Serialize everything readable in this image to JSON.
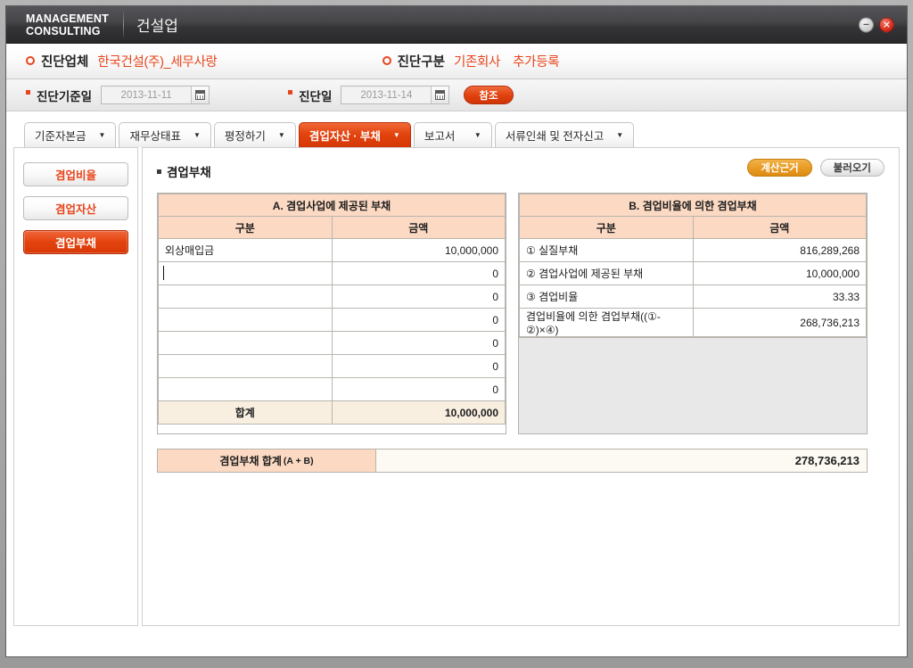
{
  "window": {
    "brand_line1": "MANAGEMENT",
    "brand_line2": "CONSULTING",
    "app_title": "건설업",
    "minimize_glyph": "–",
    "close_glyph": "✕"
  },
  "info_bar": {
    "company_label": "진단업체",
    "company_value": "한국건설(주)_세무사랑",
    "category_label": "진단구분",
    "category_value": "기존회사",
    "category_value2": "추가등록"
  },
  "date_bar": {
    "base_date_label": "진단기준일",
    "base_date_value": "2013-11-11",
    "diag_date_label": "진단일",
    "diag_date_value": "2013-11-14",
    "reference_button": "참조"
  },
  "tabs": [
    {
      "label": "기준자본금",
      "caret": "▼",
      "active": false
    },
    {
      "label": "재무상태표",
      "caret": "▼",
      "active": false
    },
    {
      "label": "평정하기",
      "caret": "▼",
      "active": false
    },
    {
      "label": "겸업자산 · 부채",
      "caret": "▼",
      "active": true
    },
    {
      "label": "보고서",
      "caret": "▼",
      "active": false
    },
    {
      "label": "서류인쇄 및 전자신고",
      "caret": "▼",
      "active": false
    }
  ],
  "sidebar": {
    "items": [
      {
        "label": "겸업비율",
        "active": false
      },
      {
        "label": "겸업자산",
        "active": false
      },
      {
        "label": "겸업부채",
        "active": true
      }
    ]
  },
  "content": {
    "section_title": "겸업부채",
    "calc_basis_button": "계산근거",
    "load_button": "불러오기"
  },
  "table_a": {
    "title": "A. 겸업사업에 제공된 부채",
    "columns": [
      "구분",
      "금액"
    ],
    "rows": [
      {
        "name": "외상매입금",
        "amount": "10,000,000",
        "editing": false
      },
      {
        "name": "",
        "amount": "0",
        "editing": true
      },
      {
        "name": "",
        "amount": "0",
        "editing": false
      },
      {
        "name": "",
        "amount": "0",
        "editing": false
      },
      {
        "name": "",
        "amount": "0",
        "editing": false
      },
      {
        "name": "",
        "amount": "0",
        "editing": false
      },
      {
        "name": "",
        "amount": "0",
        "editing": false
      }
    ],
    "sum_label": "합계",
    "sum_amount": "10,000,000"
  },
  "table_b": {
    "title": "B. 겸업비율에 의한 겸업부채",
    "columns": [
      "구분",
      "금액"
    ],
    "rows": [
      {
        "name": "① 실질부채",
        "amount": "816,289,268"
      },
      {
        "name": "② 겸업사업에 제공된 부채",
        "amount": "10,000,000"
      },
      {
        "name": "③ 겸업비율",
        "amount": "33.33"
      },
      {
        "name": "겸업비율에 의한 겸업부채((①-②)×④)",
        "amount": "268,736,213"
      }
    ]
  },
  "total_bar": {
    "label": "겸업부채 합계",
    "label_paren": "(A + B)",
    "value": "278,736,213"
  },
  "colors": {
    "accent_orange": "#e8441c",
    "table_header_peach": "#fbd9c3",
    "sum_row_cream": "#f8efe1",
    "calc_button_amber": "#e89a22"
  }
}
